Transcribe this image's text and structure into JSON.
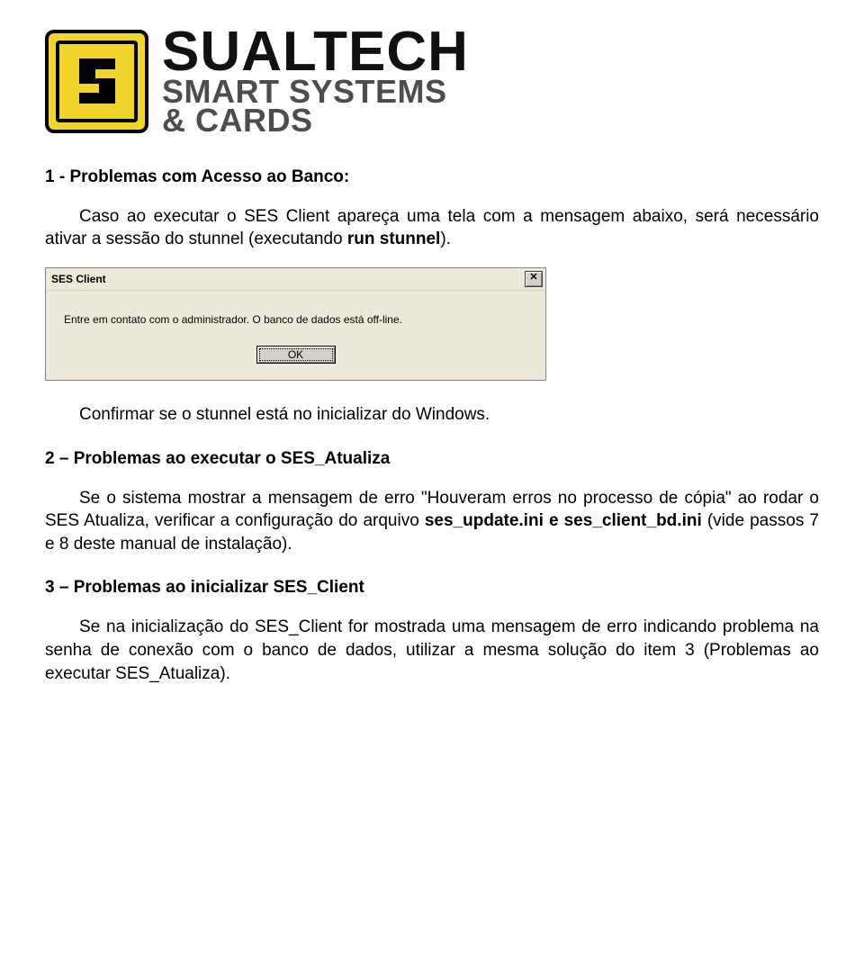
{
  "logo": {
    "brand": "SUALTECH",
    "tag1": "SMART SYSTEMS",
    "tag2": "& CARDS"
  },
  "sec1": {
    "title": "1 - Problemas com Acesso ao Banco:",
    "p1_a": "Caso ao executar o SES Client apareça uma tela com a mensagem abaixo, será necessário ativar a sessão do stunnel (executando ",
    "p1_b": "run stunnel",
    "p1_c": ")."
  },
  "dialog": {
    "title": "SES Client",
    "message": "Entre em contato com o administrador. O banco de dados está off-line.",
    "ok": "OK"
  },
  "sec1b": {
    "p2": "Confirmar se o stunnel está no inicializar do Windows."
  },
  "sec2": {
    "title": "2 – Problemas ao executar o SES_Atualiza",
    "p_a": "Se o sistema mostrar a mensagem de erro \"Houveram erros no processo de cópia\" ao rodar o SES Atualiza, verificar a configuração do arquivo ",
    "p_b": "ses_update.ini e ses_client_bd.ini",
    "p_c": " (vide passos 7 e 8 deste manual de instalação)."
  },
  "sec3": {
    "title": "3 – Problemas ao inicializar SES_Client",
    "p": "Se na inicialização do SES_Client for mostrada uma mensagem de erro indicando problema na senha de conexão com o banco de dados, utilizar a mesma solução do item 3 (Problemas ao executar SES_Atualiza)."
  }
}
